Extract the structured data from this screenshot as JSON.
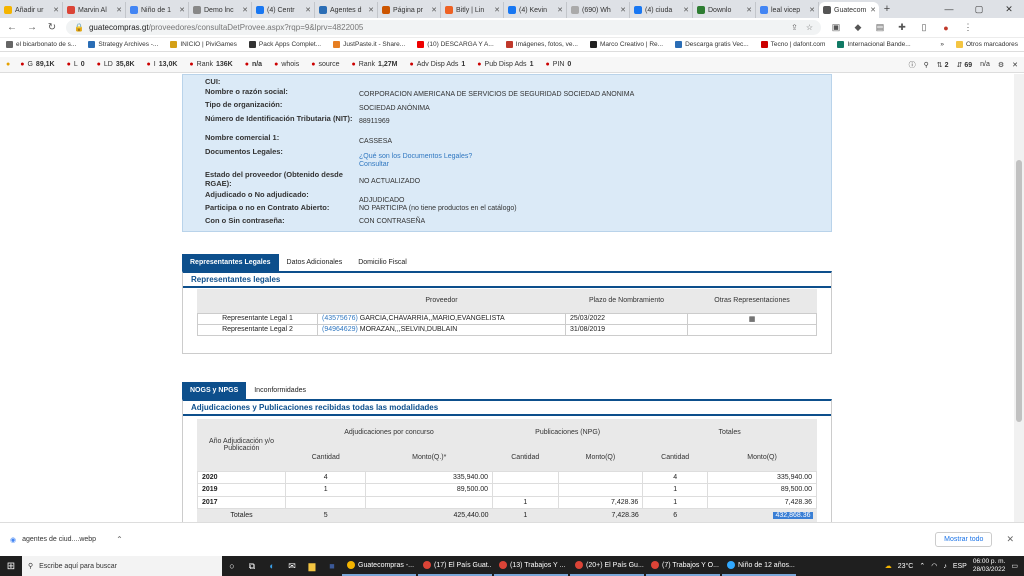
{
  "browser": {
    "tabs": [
      {
        "label": "Añadir ur",
        "color": "#f4b400"
      },
      {
        "label": "Marvin Al",
        "color": "#db4437"
      },
      {
        "label": "Niño de 1",
        "color": "#4285f4"
      },
      {
        "label": "Demo lnc",
        "color": "#888888"
      },
      {
        "label": "(4) Centr",
        "color": "#1877f2"
      },
      {
        "label": "Agentes d",
        "color": "#2a6db5"
      },
      {
        "label": "Página pr",
        "color": "#cc5500"
      },
      {
        "label": "Bitly | Lin",
        "color": "#ee6123"
      },
      {
        "label": "(4) Kevin",
        "color": "#1877f2"
      },
      {
        "label": "(690) Wh",
        "color": "#aaaaaa"
      },
      {
        "label": "(4) ciuda",
        "color": "#1877f2"
      },
      {
        "label": "Downlo",
        "color": "#2e7d32"
      },
      {
        "label": "leal vicep",
        "color": "#4285f4"
      },
      {
        "label": "Guatecom",
        "color": "#555555"
      }
    ],
    "new_tab": "+",
    "url_host": "guatecompras.gt",
    "url_path": "/proveedores/consultaDetProvee.aspx?rqp=9&lprv=4822005"
  },
  "bookmarks": [
    {
      "label": "el bicarbonato de s...",
      "color": "#666"
    },
    {
      "label": "Strategy Archives -...",
      "color": "#2a6db5"
    },
    {
      "label": "INICIO | PiviGames",
      "color": "#d4a017"
    },
    {
      "label": "Pack Apps Complet...",
      "color": "#333"
    },
    {
      "label": "JustPaste.it - Share...",
      "color": "#e67e22"
    },
    {
      "label": "(10) DESCARGA Y A...",
      "color": "#e00"
    },
    {
      "label": "Imágenes, fotos, ve...",
      "color": "#c0392b"
    },
    {
      "label": "Marco Creativo | Re...",
      "color": "#222"
    },
    {
      "label": "Descarga gratis Vec...",
      "color": "#2a6db5"
    },
    {
      "label": "Tecno | dafont.com",
      "color": "#c00"
    },
    {
      "label": "Internacional Bande...",
      "color": "#117a65"
    }
  ],
  "other_bookmarks": "Otros marcadores",
  "seo": [
    {
      "label": "G",
      "value": "89,1K"
    },
    {
      "label": "L",
      "value": "0"
    },
    {
      "label": "LD",
      "value": "35,8K"
    },
    {
      "label": "I",
      "value": "13,0K"
    },
    {
      "label": "Rank",
      "value": "136K"
    },
    {
      "label": "",
      "value": "n/a"
    },
    {
      "label": "whois",
      "value": ""
    },
    {
      "label": "source",
      "value": ""
    },
    {
      "label": "Rank",
      "value": "1,27M"
    },
    {
      "label": "Adv Disp Ads",
      "value": "1"
    },
    {
      "label": "Pub Disp Ads",
      "value": "1"
    },
    {
      "label": "PIN",
      "value": "0"
    }
  ],
  "seo_right": {
    "a": "2",
    "b": "69",
    "c": "n/a"
  },
  "provider": {
    "rows": [
      {
        "label": "CUI:",
        "value": ""
      },
      {
        "label": "Nombre o razón social:",
        "value": "CORPORACION AMERICANA DE SERVICIOS DE SEGURIDAD SOCIEDAD ANONIMA"
      },
      {
        "label": "Tipo de organización:",
        "value": "SOCIEDAD ANÓNIMA"
      },
      {
        "label": "Número de Identificación Tributaria (NIT):",
        "value": "88911969"
      },
      {
        "label": "Nombre comercial 1:",
        "value": "CASSESA"
      },
      {
        "label": "Documentos Legales:",
        "value": "¿Qué son los Documentos Legales?"
      },
      {
        "label": "Estado del proveedor (Obtenido desde RGAE):",
        "value": "NO ACTUALIZADO"
      },
      {
        "label": "Adjudicado o No adjudicado:",
        "value": "ADJUDICADO"
      },
      {
        "label": "Participa o no en Contrato Abierto:",
        "value": "NO PARTICIPA (no tiene productos en el catálogo)"
      },
      {
        "label": "Con o Sin contraseña:",
        "value": "CON CONTRASEÑA"
      }
    ],
    "consultar": "Consultar"
  },
  "rep_tabs": [
    "Representantes Legales",
    "Datos Adicionales",
    "Domicilio Fiscal"
  ],
  "rep_title": "Representantes legales",
  "rep_headers": [
    "Proveedor",
    "Plazo de Nombramiento",
    "Otras Representaciones"
  ],
  "reps": [
    {
      "role": "Representante Legal 1",
      "id": "(43575676)",
      "name": "GARCIA,CHAVARRIA,,MARIO,EVANGELISTA",
      "date": "25/03/2022"
    },
    {
      "role": "Representante Legal 2",
      "id": "(94964629)",
      "name": "MORAZAN,,,SELVIN,DUBLAIN",
      "date": "31/08/2019"
    }
  ],
  "adj_tabs": [
    "NOGS y NPGS",
    "Inconformidades"
  ],
  "adj_title": "Adjudicaciones y Publicaciones recibidas todas las modalidades",
  "adj_groups": [
    "Adjudicaciones por concurso",
    "Publicaciones (NPG)",
    "Totales"
  ],
  "adj_year_header": "Año Adjudicación y/o Publicación",
  "adj_sub": [
    "Cantidad",
    "Monto(Q.)*",
    "Cantidad",
    "Monto(Q)",
    "Cantidad",
    "Monto(Q)"
  ],
  "adj_rows": [
    {
      "year": "2020",
      "c1": "4",
      "m1": "335,940.00",
      "c2": "",
      "m2": "",
      "c3": "4",
      "m3": "335,940.00"
    },
    {
      "year": "2019",
      "c1": "1",
      "m1": "89,500.00",
      "c2": "",
      "m2": "",
      "c3": "1",
      "m3": "89,500.00"
    },
    {
      "year": "2017",
      "c1": "",
      "m1": "",
      "c2": "1",
      "m2": "7,428.36",
      "c3": "1",
      "m3": "7,428.36"
    }
  ],
  "adj_total": {
    "label": "Totales",
    "c1": "5",
    "m1": "425,440.00",
    "c2": "1",
    "m2": "7,428.36",
    "c3": "6",
    "m3": "432,868.36"
  },
  "download": {
    "file": "agentes de ciud....webp",
    "show_all": "Mostrar todo"
  },
  "taskbar": {
    "search": "Escribe aquí para buscar",
    "apps": [
      {
        "label": "Guatecompras -...",
        "color": "#f4b400"
      },
      {
        "label": "(17) El País Guat...",
        "color": "#db4437"
      },
      {
        "label": "(13) Trabajos Y ...",
        "color": "#db4437"
      },
      {
        "label": "(20+) El País Gu...",
        "color": "#db4437"
      },
      {
        "label": "(7) Trabajos Y O...",
        "color": "#db4437"
      },
      {
        "label": "Niño de 12 años...",
        "color": "#31a8ff"
      }
    ],
    "temp": "23°C",
    "lang": "ESP",
    "time": "06:00 p. m.",
    "date": "28/03/2022"
  }
}
